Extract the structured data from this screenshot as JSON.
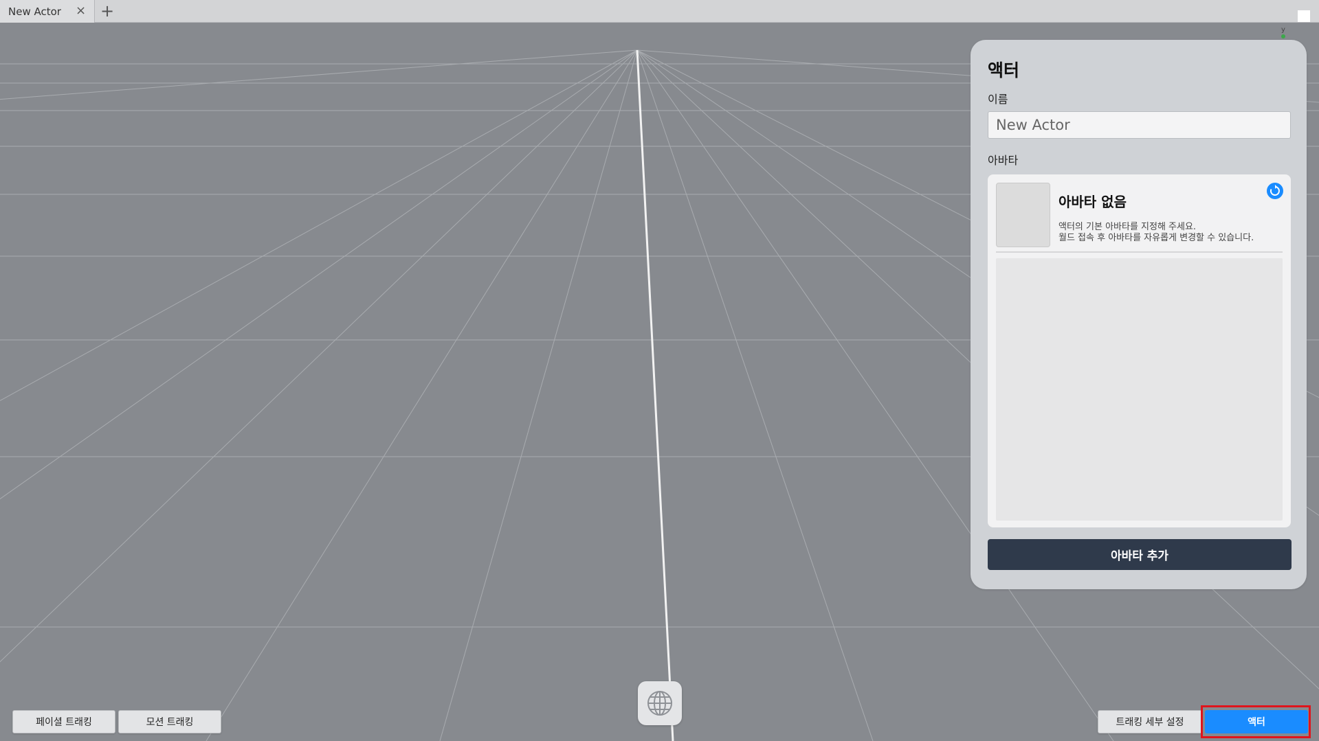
{
  "tab": {
    "title": "New Actor",
    "close_icon": "×",
    "add_icon": "+"
  },
  "viewport": {
    "axis_label": "y"
  },
  "actor_panel": {
    "title": "액터",
    "name_label": "이름",
    "name_value": "New Actor",
    "avatar_label": "아바타",
    "avatar_none_title": "아바타 없음",
    "avatar_desc_line1": "액터의 기본 아바타를 지정해 주세요.",
    "avatar_desc_line2": "월드 접속 후 아바타를 자유롭게 변경할 수 있습니다.",
    "add_avatar_button": "아바타 추가"
  },
  "bottom_bar": {
    "facial_tracking": "페이셜 트래킹",
    "motion_tracking": "모션 트래킹",
    "tracking_settings": "트래킹 세부 설정",
    "actor": "액터"
  },
  "colors": {
    "viewport_bg": "#878a8f",
    "accent_blue": "#1a8cff",
    "dark_button": "#2f3a4b",
    "highlight_red": "#e0141c"
  },
  "icons": {
    "globe": "globe-icon",
    "refresh": "refresh-icon"
  }
}
